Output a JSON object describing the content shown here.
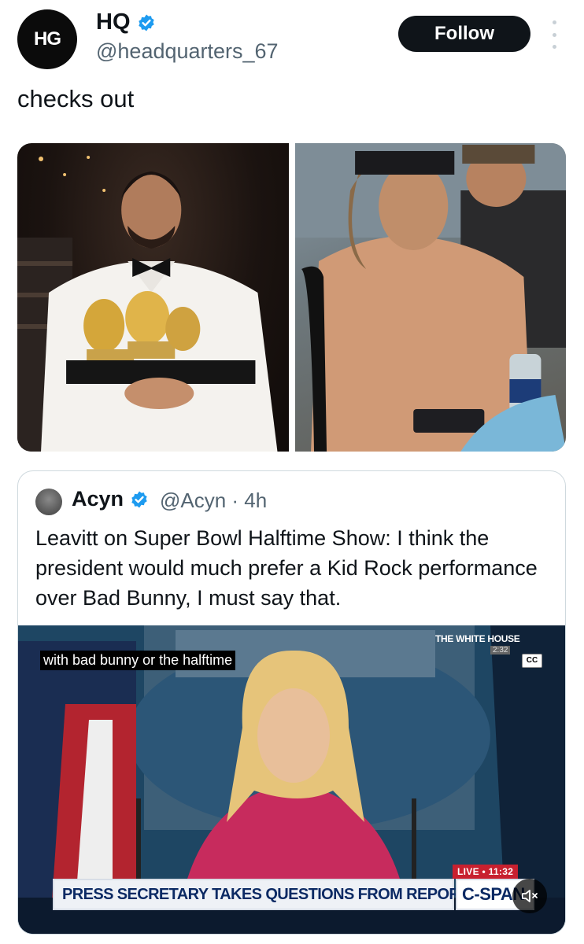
{
  "author": {
    "avatar_text": "HG",
    "display_name": "HQ",
    "handle": "@headquarters_67",
    "verified": true
  },
  "actions": {
    "follow_label": "Follow",
    "more_icon": "more-vertical-icon"
  },
  "tweet": {
    "text": "checks out"
  },
  "quoted_tweet": {
    "display_name": "Acyn",
    "handle_time": "@Acyn · 4h",
    "verified": true,
    "text": "Leavitt on Super Bowl Halftime Show: I think the president would much prefer a Kid Rock performance over Bad Bunny, I must say that.",
    "video": {
      "caption": "with bad bunny or the halftime",
      "network_label": "THE WHITE HOUSE",
      "clock": "2:32",
      "cc_label": "CC",
      "live_label": "LIVE • 11:32",
      "chyron": "PRESS SECRETARY TAKES QUESTIONS FROM REPORTERS",
      "network_logo": "C-SPAN",
      "backdrop_text": "THE W    OUSE",
      "mute_icon": "speaker-muted-icon"
    }
  },
  "colors": {
    "verified_blue": "#1d9bf0",
    "text_primary": "#0f1419",
    "text_secondary": "#536471",
    "follow_bg": "#0f1419"
  }
}
